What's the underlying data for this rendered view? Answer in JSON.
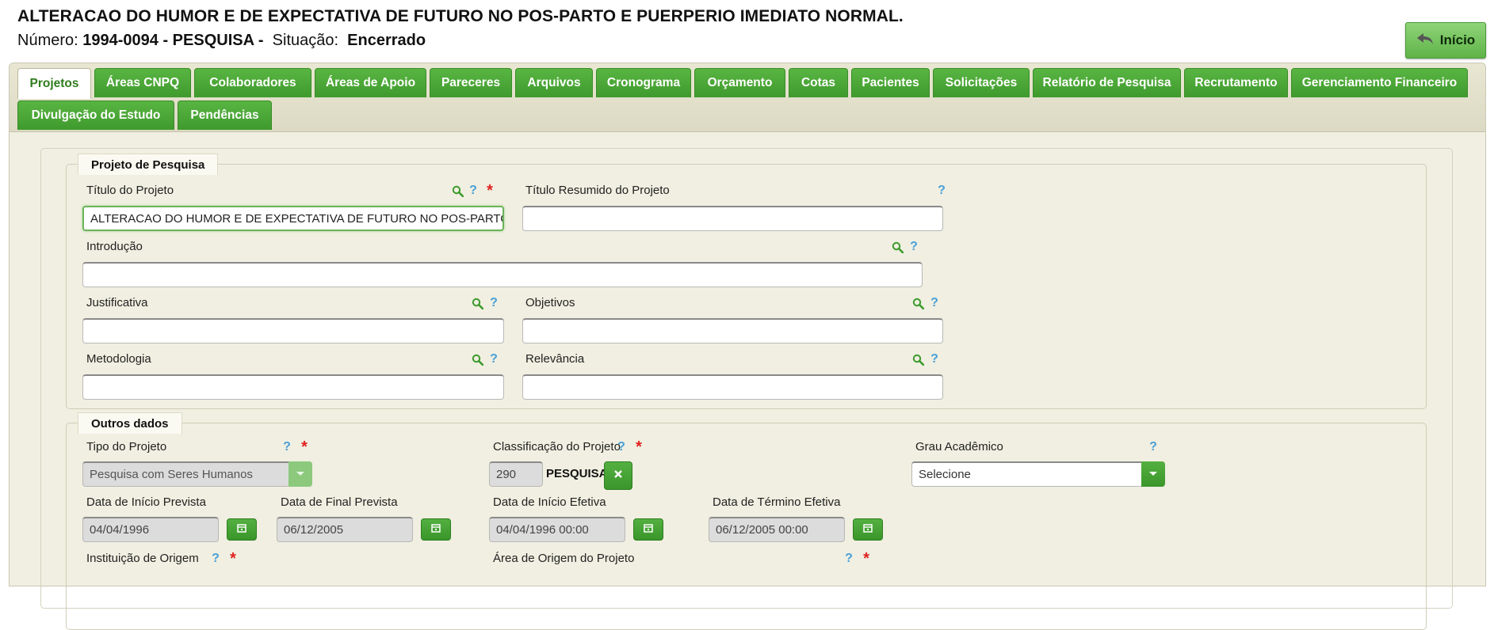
{
  "header": {
    "title": "ALTERACAO DO HUMOR E DE EXPECTATIVA DE FUTURO NO POS-PARTO E PUERPERIO IMEDIATO NORMAL.",
    "numero_label": "Número:",
    "numero_value": "1994-0094 - PESQUISA -",
    "situacao_label": "Situação:",
    "situacao_value": "Encerrado",
    "inicio_button": "Início"
  },
  "tabs": [
    {
      "label": "Projetos",
      "active": true
    },
    {
      "label": "Áreas CNPQ"
    },
    {
      "label": "Colaboradores"
    },
    {
      "label": "Áreas de Apoio"
    },
    {
      "label": "Pareceres"
    },
    {
      "label": "Arquivos"
    },
    {
      "label": "Cronograma"
    },
    {
      "label": "Orçamento"
    },
    {
      "label": "Cotas"
    },
    {
      "label": "Pacientes"
    },
    {
      "label": "Solicitações"
    },
    {
      "label": "Relatório de Pesquisa"
    },
    {
      "label": "Recrutamento"
    },
    {
      "label": "Gerenciamento Financeiro"
    },
    {
      "label": "Divulgação do Estudo"
    },
    {
      "label": "Pendências"
    }
  ],
  "projeto": {
    "legend": "Projeto de Pesquisa",
    "titulo_label": "Título do Projeto",
    "titulo_value": "ALTERACAO DO HUMOR E DE EXPECTATIVA DE FUTURO NO POS-PARTO E PUERPERIO IMEDIATO NORMAL.",
    "titulo_resumido_label": "Título Resumido do Projeto",
    "titulo_resumido_value": "",
    "introducao_label": "Introdução",
    "introducao_value": "",
    "justificativa_label": "Justificativa",
    "justificativa_value": "",
    "objetivos_label": "Objetivos",
    "objetivos_value": "",
    "metodologia_label": "Metodologia",
    "metodologia_value": "",
    "relevancia_label": "Relevância",
    "relevancia_value": ""
  },
  "outros": {
    "legend": "Outros dados",
    "tipo_label": "Tipo do Projeto",
    "tipo_value": "Pesquisa com Seres Humanos",
    "classificacao_label": "Classificação do Projeto",
    "classificacao_code": "290",
    "classificacao_name": "PESQUISA",
    "grau_label": "Grau Acadêmico",
    "grau_value": "Selecione",
    "inicio_prevista_label": "Data de Início Prevista",
    "inicio_prevista_value": "04/04/1996",
    "final_prevista_label": "Data de Final Prevista",
    "final_prevista_value": "06/12/2005",
    "inicio_efetiva_label": "Data de Início Efetiva",
    "inicio_efetiva_value": "04/04/1996 00:00",
    "termino_efetiva_label": "Data de Término Efetiva",
    "termino_efetiva_value": "06/12/2005 00:00",
    "instituicao_label": "Instituição de Origem",
    "area_origem_label": "Área de Origem do Projeto"
  },
  "colors": {
    "accent_green": "#4aa83a",
    "panel_bg": "#f0efe1",
    "required_red": "#e02020",
    "help_blue": "#4aa0d8"
  }
}
